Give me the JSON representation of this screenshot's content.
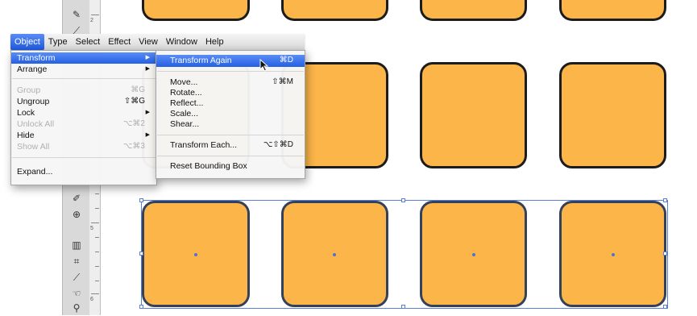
{
  "colors": {
    "tile_fill": "#fbb548",
    "tile_stroke": "#1c1c1c",
    "selection": "#5a7fd8",
    "menu_highlight": "#2a63e6"
  },
  "menubar": {
    "items": [
      "Object",
      "Type",
      "Select",
      "Effect",
      "View",
      "Window",
      "Help"
    ],
    "active": "Object"
  },
  "object_menu": {
    "items": [
      {
        "label": "Transform",
        "shortcut": "",
        "submenu": true,
        "state": "highlighted"
      },
      {
        "label": "Arrange",
        "shortcut": "",
        "submenu": true,
        "state": "enabled"
      },
      {
        "label": "Group",
        "shortcut": "⌘G",
        "submenu": false,
        "state": "disabled"
      },
      {
        "label": "Ungroup",
        "shortcut": "⇧⌘G",
        "submenu": false,
        "state": "enabled"
      },
      {
        "label": "Lock",
        "shortcut": "",
        "submenu": true,
        "state": "enabled"
      },
      {
        "label": "Unlock All",
        "shortcut": "⌥⌘2",
        "submenu": false,
        "state": "disabled"
      },
      {
        "label": "Hide",
        "shortcut": "",
        "submenu": true,
        "state": "enabled"
      },
      {
        "label": "Show All",
        "shortcut": "⌥⌘3",
        "submenu": false,
        "state": "disabled"
      },
      {
        "label": "Expand...",
        "shortcut": "",
        "submenu": false,
        "state": "enabled"
      }
    ]
  },
  "transform_menu": {
    "items": [
      {
        "label": "Transform Again",
        "shortcut": "⌘D",
        "state": "highlighted"
      },
      {
        "label": "Move...",
        "shortcut": "⇧⌘M",
        "state": "enabled"
      },
      {
        "label": "Rotate...",
        "shortcut": "",
        "state": "enabled"
      },
      {
        "label": "Reflect...",
        "shortcut": "",
        "state": "enabled"
      },
      {
        "label": "Scale...",
        "shortcut": "",
        "state": "enabled"
      },
      {
        "label": "Shear...",
        "shortcut": "",
        "state": "enabled"
      },
      {
        "label": "Transform Each...",
        "shortcut": "⌥⇧⌘D",
        "state": "enabled"
      },
      {
        "label": "Reset Bounding Box",
        "shortcut": "",
        "state": "enabled"
      }
    ]
  },
  "ruler": {
    "labels": [
      "2",
      "5",
      "6"
    ]
  },
  "tools": [
    "pen-tool-icon",
    "paintbrush-icon",
    "blob-brush-icon",
    "symbol-sprayer-icon",
    "column-graph-icon",
    "artboard-icon",
    "slice-icon",
    "hand-icon",
    "zoom-icon"
  ]
}
